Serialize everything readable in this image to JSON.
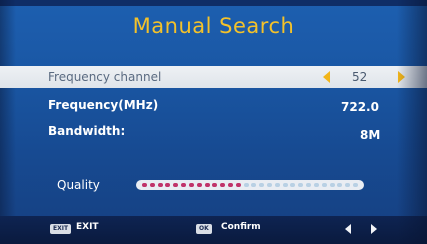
{
  "title": "Manual Search",
  "fields": {
    "frequency_channel": {
      "label": "Frequency channel",
      "value": "52"
    },
    "frequency": {
      "label": "Frequency(MHz)",
      "value": "722.0"
    },
    "bandwidth": {
      "label": "Bandwidth:",
      "value": "8M"
    }
  },
  "quality": {
    "label": "Quality",
    "level": 0.45
  },
  "footer": {
    "exit_badge": "EXIT",
    "exit_label": "EXIT",
    "ok_badge": "OK",
    "confirm_label": "Confirm"
  },
  "colors": {
    "title": "#f4c22a",
    "accent_arrow": "#f2b51a",
    "quality_filled": "#c0336a",
    "quality_empty": "#b8d0e4"
  },
  "icons": {
    "channel_left": "triangle-left-icon",
    "channel_right": "triangle-right-icon",
    "nav_left": "chevron-left-icon",
    "nav_right": "chevron-right-icon"
  }
}
